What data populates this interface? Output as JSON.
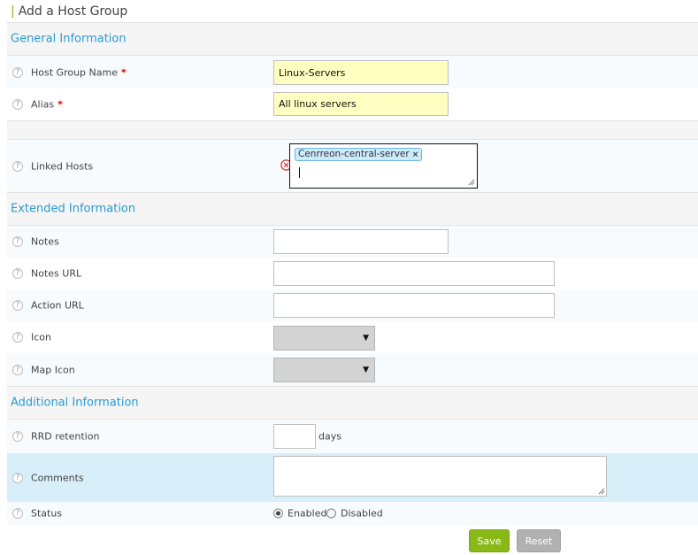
{
  "page": {
    "title": "Add a Host Group"
  },
  "sections": {
    "general": "General Information",
    "extended": "Extended Information",
    "additional": "Additional Information"
  },
  "help_glyph": "?",
  "required_mark": "*",
  "fields": {
    "host_group_name": {
      "label": "Host Group Name",
      "value": "Linux-Servers"
    },
    "alias": {
      "label": "Alias",
      "value": "All linux servers"
    },
    "linked_hosts": {
      "label": "Linked Hosts",
      "chips": [
        "Cenrreon-central-server"
      ],
      "chip_remove": "×"
    },
    "notes": {
      "label": "Notes",
      "value": ""
    },
    "notes_url": {
      "label": "Notes URL",
      "value": ""
    },
    "action_url": {
      "label": "Action URL",
      "value": ""
    },
    "icon": {
      "label": "Icon",
      "selected": ""
    },
    "map_icon": {
      "label": "Map Icon",
      "selected": ""
    },
    "rrd_retention": {
      "label": "RRD retention",
      "value": "",
      "unit": "days"
    },
    "comments": {
      "label": "Comments",
      "value": ""
    },
    "status": {
      "label": "Status",
      "options": [
        "Enabled",
        "Disabled"
      ],
      "selected": "Enabled"
    }
  },
  "select_arrow": "▼",
  "buttons": {
    "save": "Save",
    "reset": "Reset"
  },
  "colors": {
    "accent_green": "#88b917",
    "section_blue": "#2a9bd1",
    "required_red": "#e00000",
    "required_field_bg": "#ffffc1",
    "clear_icon_red": "#d9363e",
    "highlight_row": "#d8eef8"
  }
}
